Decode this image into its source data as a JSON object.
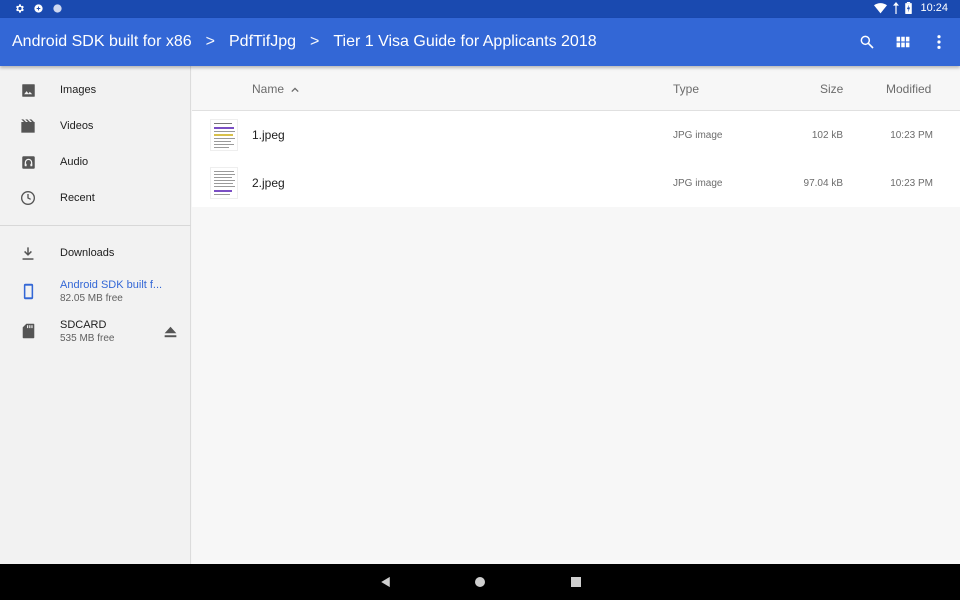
{
  "status_bar": {
    "time": "10:24",
    "icons_left": [
      "gear-icon",
      "sync-icon",
      "circle-icon"
    ],
    "icons_right": [
      "wifi-icon",
      "battery-icon"
    ]
  },
  "app_bar": {
    "breadcrumbs": [
      "Android SDK built for x86",
      "PdfTifJpg",
      "Tier 1 Visa Guide for Applicants 2018"
    ],
    "separator": ">",
    "actions": [
      "search-icon",
      "grid-view-icon",
      "more-vert-icon"
    ]
  },
  "sidebar": {
    "items": [
      {
        "label": "Images",
        "icon": "image-icon"
      },
      {
        "label": "Videos",
        "icon": "video-icon"
      },
      {
        "label": "Audio",
        "icon": "audio-icon"
      },
      {
        "label": "Recent",
        "icon": "clock-icon"
      },
      {
        "label": "Downloads",
        "icon": "download-icon"
      },
      {
        "label": "Android SDK built f...",
        "sublabel": "82.05 MB free",
        "icon": "phone-icon",
        "selected": true
      },
      {
        "label": "SDCARD",
        "sublabel": "535 MB free",
        "icon": "sdcard-icon",
        "action": "eject-icon"
      }
    ]
  },
  "columns": {
    "name": "Name",
    "type": "Type",
    "size": "Size",
    "modified": "Modified",
    "sort_indicator": "^"
  },
  "files": [
    {
      "name": "1.jpeg",
      "type": "JPG image",
      "size": "102 kB",
      "modified": "10:23 PM"
    },
    {
      "name": "2.jpeg",
      "type": "JPG image",
      "size": "97.04 kB",
      "modified": "10:23 PM"
    }
  ],
  "colors": {
    "status_bar": "#1a4ab0",
    "app_bar": "#3367d6",
    "selected_text": "#3367d6"
  }
}
